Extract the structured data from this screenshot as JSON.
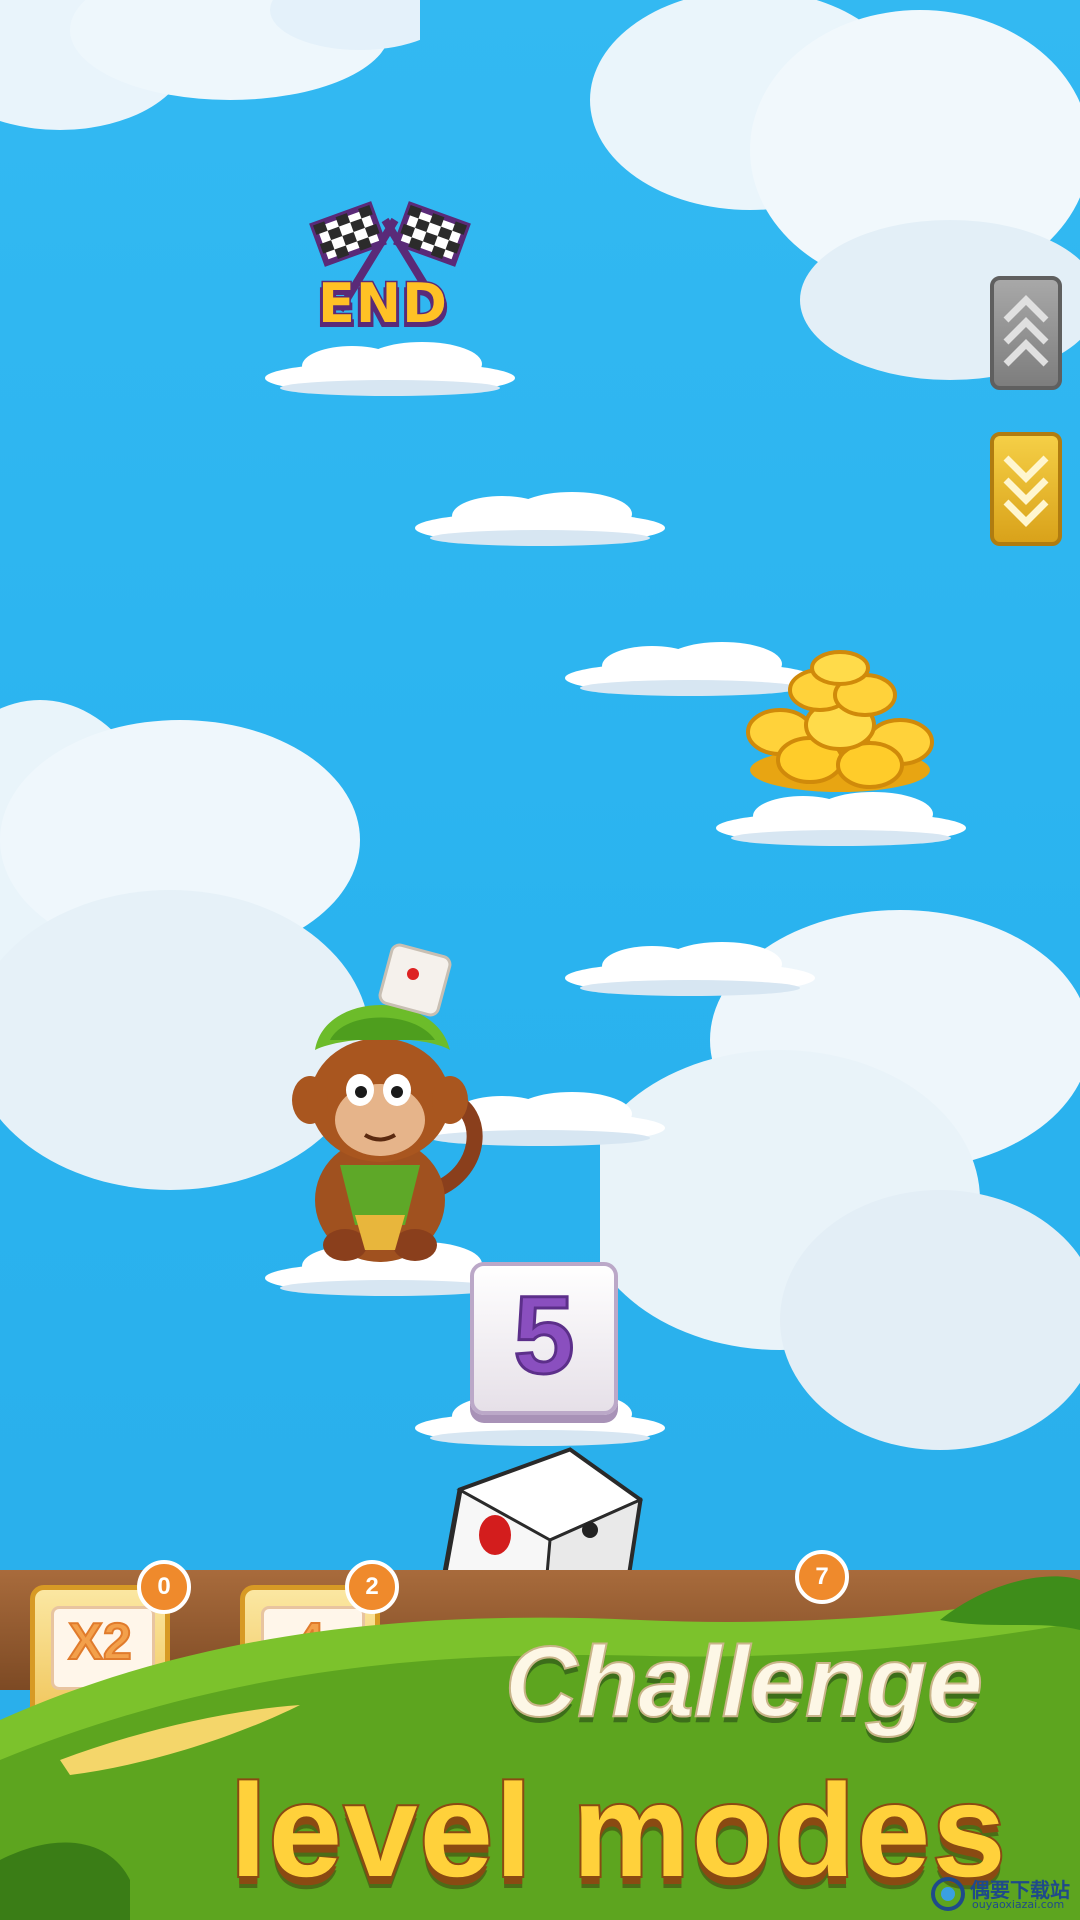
{
  "board": {
    "end_label": "END",
    "dice_value": "5"
  },
  "controls": {
    "scroll_up_icon": "triple-chevron-up-icon",
    "scroll_down_icon": "triple-chevron-down-icon"
  },
  "items": [
    {
      "label": "X2",
      "count": "0"
    },
    {
      "label": "4",
      "count": "2"
    },
    {
      "label": "",
      "count": "7"
    }
  ],
  "caption": {
    "line1": "Challenge",
    "line2": "level modes"
  },
  "watermark": {
    "cn": "偶要下载站",
    "en": "ouyaoxiazai.com"
  },
  "colors": {
    "sky": "#2bb6ef",
    "end_text": "#ffc125",
    "caption_gold": "#ffd13b",
    "badge": "#ef8a2c"
  }
}
